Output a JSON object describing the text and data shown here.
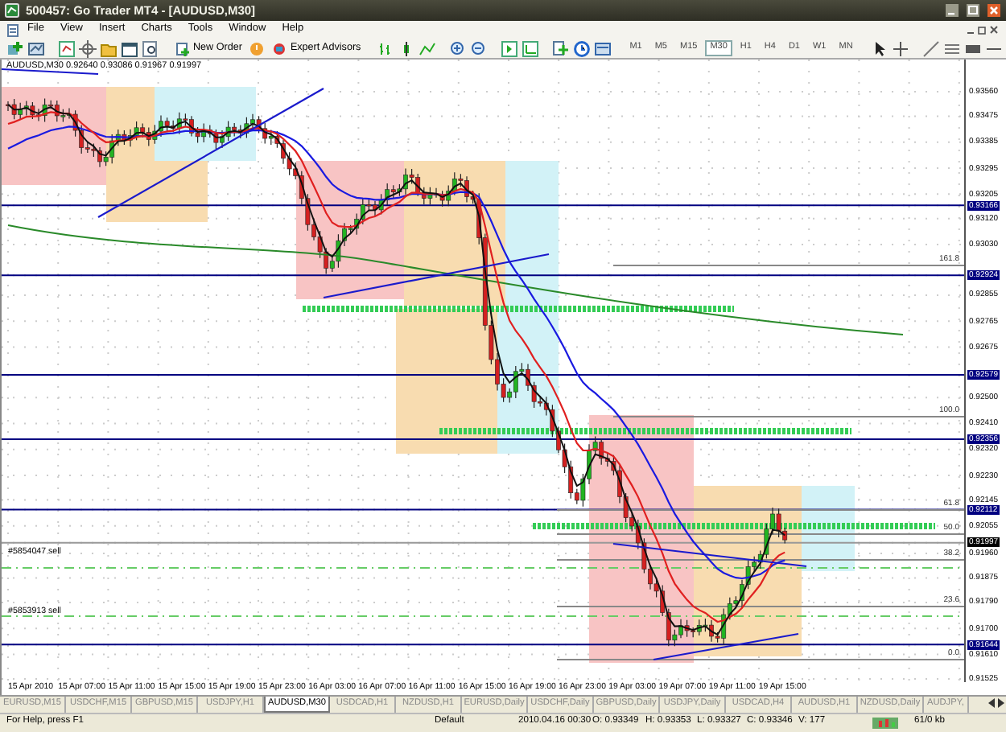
{
  "window": {
    "title": "500457: Go Trader MT4 - [AUDUSD,M30]"
  },
  "menu": [
    "File",
    "View",
    "Insert",
    "Charts",
    "Tools",
    "Window",
    "Help"
  ],
  "toolbar": {
    "buttons": [
      {
        "label": "New Order"
      },
      {
        "label": "Expert Advisors"
      }
    ],
    "timeframes": [
      {
        "label": "M1",
        "selected": false
      },
      {
        "label": "M5",
        "selected": false
      },
      {
        "label": "M15",
        "selected": false
      },
      {
        "label": "M30",
        "selected": true
      },
      {
        "label": "H1",
        "selected": false
      },
      {
        "label": "H4",
        "selected": false
      },
      {
        "label": "D1",
        "selected": false
      },
      {
        "label": "W1",
        "selected": false
      },
      {
        "label": "MN",
        "selected": false
      }
    ]
  },
  "chart": {
    "header": "AUDUSD,M30  0.92640 0.93086 0.91967 0.91997",
    "price_labels": [
      {
        "text": "0.93560"
      },
      {
        "text": "0.93475"
      },
      {
        "text": "0.93385"
      },
      {
        "text": "0.93295"
      },
      {
        "text": "0.93205"
      },
      {
        "text": "0.93166",
        "color": "#000080"
      },
      {
        "text": "0.93120"
      },
      {
        "text": "0.93030"
      },
      {
        "text": "0.92924",
        "color": "#000080"
      },
      {
        "text": "0.92855"
      },
      {
        "text": "0.92765"
      },
      {
        "text": "0.92675"
      },
      {
        "text": "0.92579",
        "color": "#000080"
      },
      {
        "text": "0.92500"
      },
      {
        "text": "0.92410"
      },
      {
        "text": "0.92356",
        "color": "#000080"
      },
      {
        "text": "0.92320"
      },
      {
        "text": "0.92230"
      },
      {
        "text": "0.92145"
      },
      {
        "text": "0.92112",
        "color": "#000080"
      },
      {
        "text": "0.92055"
      },
      {
        "text": "0.91997",
        "color": "#000000"
      },
      {
        "text": "0.91960"
      },
      {
        "text": "0.91875"
      },
      {
        "text": "0.91790"
      },
      {
        "text": "0.91700"
      },
      {
        "text": "0.91644",
        "color": "#000080"
      },
      {
        "text": "0.91610"
      },
      {
        "text": "0.91525"
      }
    ],
    "fib_levels": [
      "161.8",
      "100.0",
      "61.8",
      "50.0",
      "38.2",
      "23.6",
      "0.0"
    ],
    "order_labels": [
      "#5854047 sell",
      "#5853913 sell"
    ],
    "time_labels": [
      "15 Apr 2010",
      "15 Apr 07:00",
      "15 Apr 11:00",
      "15 Apr 15:00",
      "15 Apr 19:00",
      "15 Apr 23:00",
      "16 Apr 03:00",
      "16 Apr 07:00",
      "16 Apr 11:00",
      "16 Apr 15:00",
      "16 Apr 19:00",
      "16 Apr 23:00",
      "19 Apr 03:00",
      "19 Apr 07:00",
      "19 Apr 11:00",
      "19 Apr 15:00"
    ]
  },
  "tabs": [
    {
      "label": "EURUSD,M15",
      "selected": false
    },
    {
      "label": "USDCHF,M15",
      "selected": false
    },
    {
      "label": "GBPUSD,M15",
      "selected": false
    },
    {
      "label": "USDJPY,H1",
      "selected": false
    },
    {
      "label": "AUDUSD,M30",
      "selected": true
    },
    {
      "label": "USDCAD,H1",
      "selected": false
    },
    {
      "label": "NZDUSD,H1",
      "selected": false
    },
    {
      "label": "EURUSD,Daily",
      "selected": false
    },
    {
      "label": "USDCHF,Daily",
      "selected": false
    },
    {
      "label": "GBPUSD,Daily",
      "selected": false
    },
    {
      "label": "USDJPY,Daily",
      "selected": false
    },
    {
      "label": "USDCAD,H4",
      "selected": false
    },
    {
      "label": "AUDUSD,H1",
      "selected": false
    },
    {
      "label": "NZDUSD,Daily",
      "selected": false
    },
    {
      "label": "AUDJPY,",
      "selected": false
    }
  ],
  "status_bar": {
    "help": "For Help, press F1",
    "profile": "Default",
    "time": "2010.04.16 00:30",
    "open": "O: 0.93349",
    "high": "H: 0.93353",
    "low": "L: 0.93327",
    "close": "C: 0.93346",
    "volume": "V: 177",
    "traffic": "61/0 kb"
  }
}
